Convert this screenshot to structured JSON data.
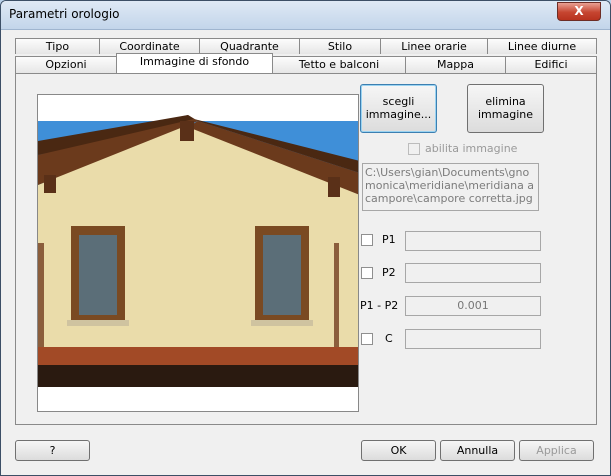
{
  "window": {
    "title": "Parametri orologio",
    "close_glyph": "X"
  },
  "tabs_row1": [
    "Tipo",
    "Coordinate",
    "Quadrante",
    "Stilo",
    "Linee orarie",
    "Linee diurne"
  ],
  "tabs_row2": [
    "Opzioni",
    "Immagine di sfondo",
    "Tetto e balconi",
    "Mappa",
    "Edifici"
  ],
  "selected_tab": "Immagine di sfondo",
  "panel": {
    "choose_image_label": "scegli immagine...",
    "remove_image_label": "elimina immagine",
    "enable_image_label": "abilita immagine",
    "image_path": "C:\\Users\\gian\\Documents\\gnomonica\\meridiane\\meridiana a campore\\campore corretta.jpg",
    "p1_label": "P1",
    "p1_value": "",
    "p2_label": "P2",
    "p2_value": "",
    "p1p2_label": "P1 - P2",
    "p1p2_value": "0.001",
    "c_label": "C",
    "c_value": ""
  },
  "footer": {
    "help": "?",
    "ok": "OK",
    "cancel": "Annulla",
    "apply": "Applica"
  },
  "colors": {
    "sky": "#3f8fd8",
    "wall": "#eadcaa",
    "roof_wood": "#6b3a1c",
    "tiles": "#a24a26"
  }
}
